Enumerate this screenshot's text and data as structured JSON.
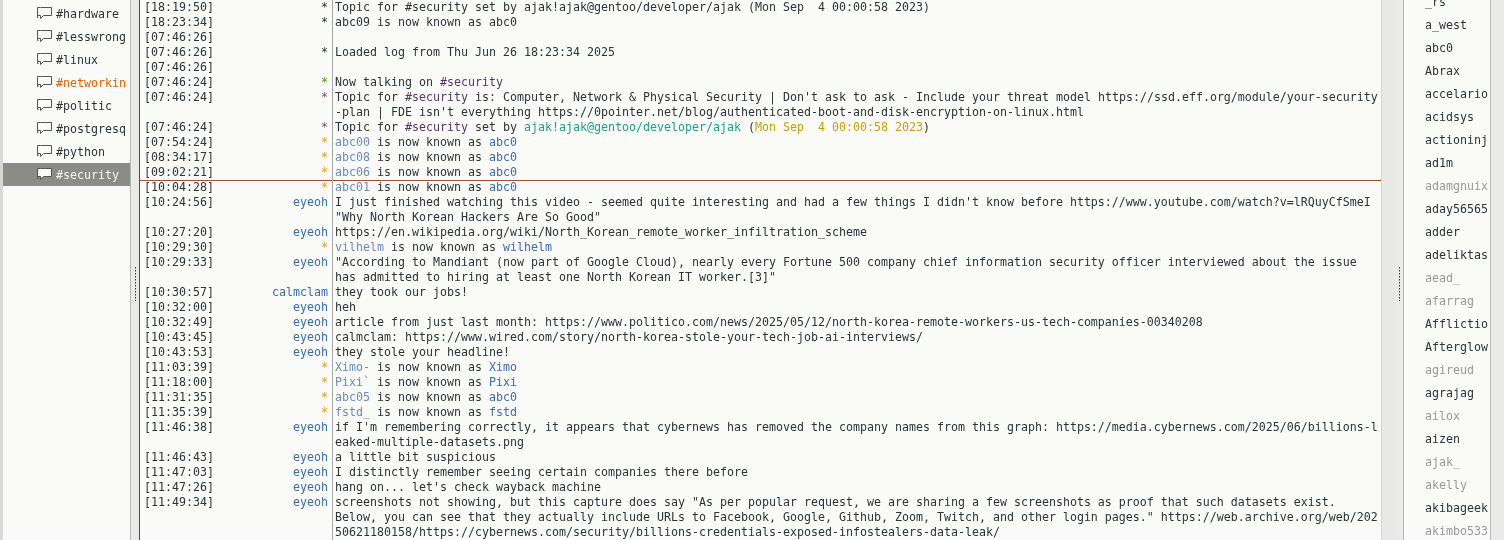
{
  "channels": [
    {
      "label": "#hardware",
      "selected": false,
      "activity": false
    },
    {
      "label": "#lesswrong",
      "selected": false,
      "activity": false
    },
    {
      "label": "#linux",
      "selected": false,
      "activity": false
    },
    {
      "label": "#networkin",
      "selected": false,
      "activity": true
    },
    {
      "label": "#politic",
      "selected": false,
      "activity": false
    },
    {
      "label": "#postgresq",
      "selected": false,
      "activity": false
    },
    {
      "label": "#python",
      "selected": false,
      "activity": false
    },
    {
      "label": "#security",
      "selected": true,
      "activity": false
    }
  ],
  "chat": {
    "lines": [
      {
        "time": "[18:19:50]",
        "nick": "*",
        "kind": "info",
        "marker": false,
        "parts": [
          {
            "text": "Topic for #security set by ajak!ajak@gentoo/developer/ajak (Mon Sep  4 00:00:58 2023)",
            "kind": "plain"
          }
        ]
      },
      {
        "time": "[18:23:34]",
        "nick": "*",
        "kind": "info",
        "marker": false,
        "parts": [
          {
            "text": "abc09 is now known as abc0",
            "kind": "plain"
          }
        ]
      },
      {
        "time": "[07:46:26]",
        "marker": false
      },
      {
        "time": "[07:46:26]",
        "nick": "*",
        "kind": "info",
        "marker": false,
        "parts": [
          {
            "text": "Loaded log from Thu Jun 26 18:23:34 2025",
            "kind": "plain"
          }
        ]
      },
      {
        "time": "[07:46:26]",
        "marker": false
      },
      {
        "time": "[07:46:24]",
        "nick": "*",
        "kind": "join",
        "marker": false,
        "parts": [
          {
            "text": "Now talking on ",
            "kind": "plain"
          },
          {
            "text": "#security",
            "kind": "channel"
          }
        ]
      },
      {
        "time": "[07:46:24]",
        "nick": "*",
        "kind": "topic",
        "marker": false,
        "parts": [
          {
            "text": "Topic for ",
            "kind": "plain"
          },
          {
            "text": "#security",
            "kind": "channel"
          },
          {
            "text": " is: Computer, Network & Physical Security | Don't ask to ask - Include your threat model https://ssd.eff.org/module/your-security\n-plan | FDE isn't everything https://0pointer.net/blog/authenticated-boot-and-disk-encryption-on-linux.html",
            "kind": "plain"
          }
        ]
      },
      {
        "time": "[07:46:24]",
        "nick": "*",
        "kind": "topic",
        "marker": false,
        "parts": [
          {
            "text": "Topic for ",
            "kind": "plain"
          },
          {
            "text": "#security",
            "kind": "channel"
          },
          {
            "text": " set by ",
            "kind": "plain"
          },
          {
            "text": "ajak!ajak@gentoo/developer/ajak",
            "kind": "host"
          },
          {
            "text": " (",
            "kind": "plain"
          },
          {
            "text": "Mon Sep  4 00:00:58 2023",
            "kind": "date"
          },
          {
            "text": ")",
            "kind": "plain"
          }
        ]
      },
      {
        "time": "[07:54:24]",
        "nick": "*",
        "kind": "nick_change",
        "marker": false,
        "parts": [
          {
            "text": "abc00",
            "kind": "old_nick"
          },
          {
            "text": " is now known as ",
            "kind": "plain"
          },
          {
            "text": "abc0",
            "kind": "new_nick"
          }
        ]
      },
      {
        "time": "[08:34:17]",
        "nick": "*",
        "kind": "nick_change",
        "marker": false,
        "parts": [
          {
            "text": "abc08",
            "kind": "old_nick"
          },
          {
            "text": " is now known as ",
            "kind": "plain"
          },
          {
            "text": "abc0",
            "kind": "new_nick"
          }
        ]
      },
      {
        "time": "[09:02:21]",
        "nick": "*",
        "kind": "nick_change",
        "marker": false,
        "parts": [
          {
            "text": "abc06",
            "kind": "old_nick"
          },
          {
            "text": " is now known as ",
            "kind": "plain"
          },
          {
            "text": "abc0",
            "kind": "new_nick"
          }
        ]
      },
      {
        "time": "[10:04:28]",
        "nick": "*",
        "kind": "nick_change",
        "marker": true,
        "parts": [
          {
            "text": "abc01",
            "kind": "old_nick"
          },
          {
            "text": " is now known as ",
            "kind": "plain"
          },
          {
            "text": "abc0",
            "kind": "new_nick"
          }
        ]
      },
      {
        "time": "[10:24:56]",
        "nick": "eyeoh",
        "kind": "message",
        "marker": false,
        "parts": [
          {
            "text": "I just finished watching this video - seemed quite interesting and had a few things I didn't know before https://www.youtube.com/watch?v=lRQuyCfSmeI\n\"Why North Korean Hackers Are So Good\"",
            "kind": "plain"
          }
        ]
      },
      {
        "time": "[10:27:20]",
        "nick": "eyeoh",
        "kind": "message",
        "marker": false,
        "parts": [
          {
            "text": "https://en.wikipedia.org/wiki/North_Korean_remote_worker_infiltration_scheme",
            "kind": "plain"
          }
        ]
      },
      {
        "time": "[10:29:30]",
        "nick": "*",
        "kind": "nick_change",
        "marker": false,
        "parts": [
          {
            "text": "vilhelm",
            "kind": "old_nick"
          },
          {
            "text": " is now known as ",
            "kind": "plain"
          },
          {
            "text": "wilhelm",
            "kind": "new_nick"
          }
        ]
      },
      {
        "time": "[10:29:33]",
        "nick": "eyeoh",
        "kind": "message",
        "marker": false,
        "parts": [
          {
            "text": "\"According to Mandiant (now part of Google Cloud), nearly every Fortune 500 company chief information security officer interviewed about the issue\nhas admitted to hiring at least one North Korean IT worker.[3]\"",
            "kind": "plain"
          }
        ]
      },
      {
        "time": "[10:30:57]",
        "nick": "calmclam",
        "kind": "message",
        "marker": false,
        "parts": [
          {
            "text": "they took our jobs!",
            "kind": "plain"
          }
        ]
      },
      {
        "time": "[10:32:00]",
        "nick": "eyeoh",
        "kind": "message",
        "marker": false,
        "parts": [
          {
            "text": "heh",
            "kind": "plain"
          }
        ]
      },
      {
        "time": "[10:32:49]",
        "nick": "eyeoh",
        "kind": "message",
        "marker": false,
        "parts": [
          {
            "text": "article from just last month: https://www.politico.com/news/2025/05/12/north-korea-remote-workers-us-tech-companies-00340208",
            "kind": "plain"
          }
        ]
      },
      {
        "time": "[10:43:45]",
        "nick": "eyeoh",
        "kind": "message",
        "marker": false,
        "parts": [
          {
            "text": "calmclam: https://www.wired.com/story/north-korea-stole-your-tech-job-ai-interviews/",
            "kind": "plain"
          }
        ]
      },
      {
        "time": "[10:43:53]",
        "nick": "eyeoh",
        "kind": "message",
        "marker": false,
        "parts": [
          {
            "text": "they stole your headline!",
            "kind": "plain"
          }
        ]
      },
      {
        "time": "[11:03:39]",
        "nick": "*",
        "kind": "nick_change",
        "marker": false,
        "parts": [
          {
            "text": "Ximo-",
            "kind": "old_nick"
          },
          {
            "text": " is now known as ",
            "kind": "plain"
          },
          {
            "text": "Ximo",
            "kind": "new_nick"
          }
        ]
      },
      {
        "time": "[11:18:00]",
        "nick": "*",
        "kind": "nick_change",
        "marker": false,
        "parts": [
          {
            "text": "Pixi`",
            "kind": "old_nick"
          },
          {
            "text": " is now known as ",
            "kind": "plain"
          },
          {
            "text": "Pixi",
            "kind": "new_nick"
          }
        ]
      },
      {
        "time": "[11:31:35]",
        "nick": "*",
        "kind": "nick_change",
        "marker": false,
        "parts": [
          {
            "text": "abc05",
            "kind": "old_nick"
          },
          {
            "text": " is now known as ",
            "kind": "plain"
          },
          {
            "text": "abc0",
            "kind": "new_nick"
          }
        ]
      },
      {
        "time": "[11:35:39]",
        "nick": "*",
        "kind": "nick_change",
        "marker": false,
        "parts": [
          {
            "text": "fstd_",
            "kind": "old_nick"
          },
          {
            "text": " is now known as ",
            "kind": "plain"
          },
          {
            "text": "fstd",
            "kind": "new_nick"
          }
        ]
      },
      {
        "time": "[11:46:38]",
        "nick": "eyeoh",
        "kind": "message",
        "marker": false,
        "parts": [
          {
            "text": "if I'm remembering correctly, it appears that cybernews has removed the company names from this graph: https://media.cybernews.com/2025/06/billions-l\neaked-multiple-datasets.png",
            "kind": "plain"
          }
        ]
      },
      {
        "time": "[11:46:43]",
        "nick": "eyeoh",
        "kind": "message",
        "marker": false,
        "parts": [
          {
            "text": "a little bit suspicious",
            "kind": "plain"
          }
        ]
      },
      {
        "time": "[11:47:03]",
        "nick": "eyeoh",
        "kind": "message",
        "marker": false,
        "parts": [
          {
            "text": "I distinctly remember seeing certain companies there before",
            "kind": "plain"
          }
        ]
      },
      {
        "time": "[11:47:26]",
        "nick": "eyeoh",
        "kind": "message",
        "marker": false,
        "parts": [
          {
            "text": "hang on... let's check wayback machine",
            "kind": "plain"
          }
        ]
      },
      {
        "time": "[11:49:34]",
        "nick": "eyeoh",
        "kind": "message",
        "marker": false,
        "parts": [
          {
            "text": "screenshots not showing, but this capture does say \"As per popular request, we are sharing a few screenshots as proof that such datasets exist.\nBelow, you can see that they actually include URLs to Facebook, Google, Github, Zoom, Twitch, and other login pages.\" https://web.archive.org/web/202\n50621180158/https://cybernews.com/security/billions-credentials-exposed-infostealers-data-leak/",
            "kind": "plain"
          }
        ]
      }
    ]
  },
  "users": [
    {
      "nick": "_rs",
      "away": false
    },
    {
      "nick": "a_west",
      "away": false
    },
    {
      "nick": "abc0",
      "away": false
    },
    {
      "nick": "Abrax",
      "away": false
    },
    {
      "nick": "accelario",
      "away": false
    },
    {
      "nick": "acidsys",
      "away": false
    },
    {
      "nick": "actioninj",
      "away": false
    },
    {
      "nick": "ad1m",
      "away": false
    },
    {
      "nick": "adamgnuix",
      "away": true
    },
    {
      "nick": "aday56565",
      "away": false
    },
    {
      "nick": "adder",
      "away": false
    },
    {
      "nick": "adeliktas",
      "away": false
    },
    {
      "nick": "aead_",
      "away": true
    },
    {
      "nick": "afarrag",
      "away": true
    },
    {
      "nick": "Afflictio",
      "away": false
    },
    {
      "nick": "Afterglow",
      "away": false
    },
    {
      "nick": "agireud",
      "away": true
    },
    {
      "nick": "agrajag",
      "away": false
    },
    {
      "nick": "ailox",
      "away": true
    },
    {
      "nick": "aizen",
      "away": false
    },
    {
      "nick": "ajak_",
      "away": true
    },
    {
      "nick": "akelly",
      "away": true
    },
    {
      "nick": "akibageek",
      "away": false
    },
    {
      "nick": "akimbo533",
      "away": true
    }
  ]
}
